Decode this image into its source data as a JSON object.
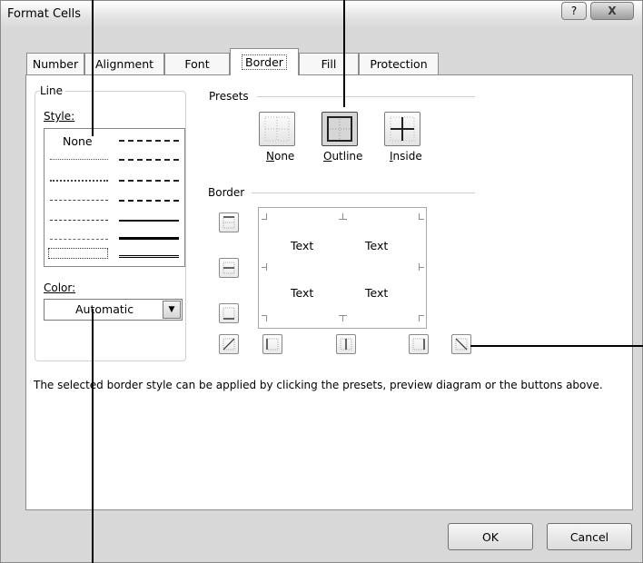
{
  "window": {
    "title": "Format Cells",
    "help_glyph": "?",
    "close_glyph": "X"
  },
  "tabs": [
    {
      "label": "Number"
    },
    {
      "label": "Alignment"
    },
    {
      "label": "Font"
    },
    {
      "label": "Border",
      "active": true
    },
    {
      "label": "Fill"
    },
    {
      "label": "Protection"
    }
  ],
  "line_group": {
    "title": "Line",
    "style_label": "Style:",
    "style_none": "None",
    "color_label": "Color:",
    "color_value": "Automatic"
  },
  "presets": {
    "title": "Presets",
    "items": [
      {
        "label": "None",
        "accel": "N",
        "rest": "one",
        "icon": "preset-none-icon"
      },
      {
        "label": "Outline",
        "accel": "O",
        "rest": "utline",
        "icon": "preset-outline-icon",
        "pressed": true
      },
      {
        "label": "Inside",
        "accel": "I",
        "rest": "nside",
        "icon": "preset-inside-icon"
      }
    ]
  },
  "border": {
    "title": "Border",
    "preview_texts": [
      "Text",
      "Text",
      "Text",
      "Text"
    ]
  },
  "description": "The selected border style can be applied by clicking the presets, preview diagram or the buttons above.",
  "buttons": {
    "ok": "OK",
    "cancel": "Cancel"
  },
  "colors": {
    "window_bg": "#d8d8d8",
    "panel_bg": "#ffffff",
    "border_gray": "#8d8d8d"
  }
}
